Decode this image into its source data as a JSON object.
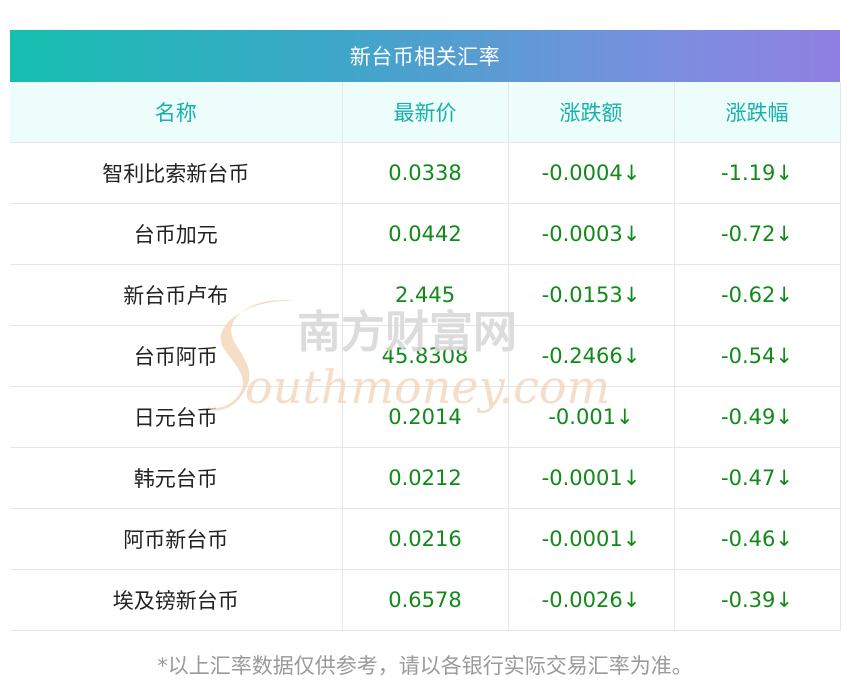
{
  "table": {
    "title": "新台币相关汇率",
    "headers": [
      "名称",
      "最新价",
      "涨跌额",
      "涨跌幅"
    ],
    "rows": [
      {
        "name": "智利比索新台币",
        "price": "0.0338",
        "change": "-0.0004↓",
        "pct": "-1.19↓"
      },
      {
        "name": "台币加元",
        "price": "0.0442",
        "change": "-0.0003↓",
        "pct": "-0.72↓"
      },
      {
        "name": "新台币卢布",
        "price": "2.445",
        "change": "-0.0153↓",
        "pct": "-0.62↓"
      },
      {
        "name": "台币阿币",
        "price": "45.8308",
        "change": "-0.2466↓",
        "pct": "-0.54↓"
      },
      {
        "name": "日元台币",
        "price": "0.2014",
        "change": "-0.001↓",
        "pct": "-0.49↓"
      },
      {
        "name": "韩元台币",
        "price": "0.0212",
        "change": "-0.0001↓",
        "pct": "-0.47↓"
      },
      {
        "name": "阿币新台币",
        "price": "0.0216",
        "change": "-0.0001↓",
        "pct": "-0.46↓"
      },
      {
        "name": "埃及镑新台币",
        "price": "0.6578",
        "change": "-0.0026↓",
        "pct": "-0.39↓"
      }
    ]
  },
  "footnote": "*以上汇率数据仅供参考，请以各银行实际交易汇率为准。",
  "watermark": {
    "cn": "南方财富网",
    "en": "outhmoney.com"
  },
  "colors": {
    "header_text": "#18b1a8",
    "value_green": "#128a1a",
    "title_gradient_start": "#16bfb0",
    "title_gradient_end": "#8f7fe0"
  }
}
